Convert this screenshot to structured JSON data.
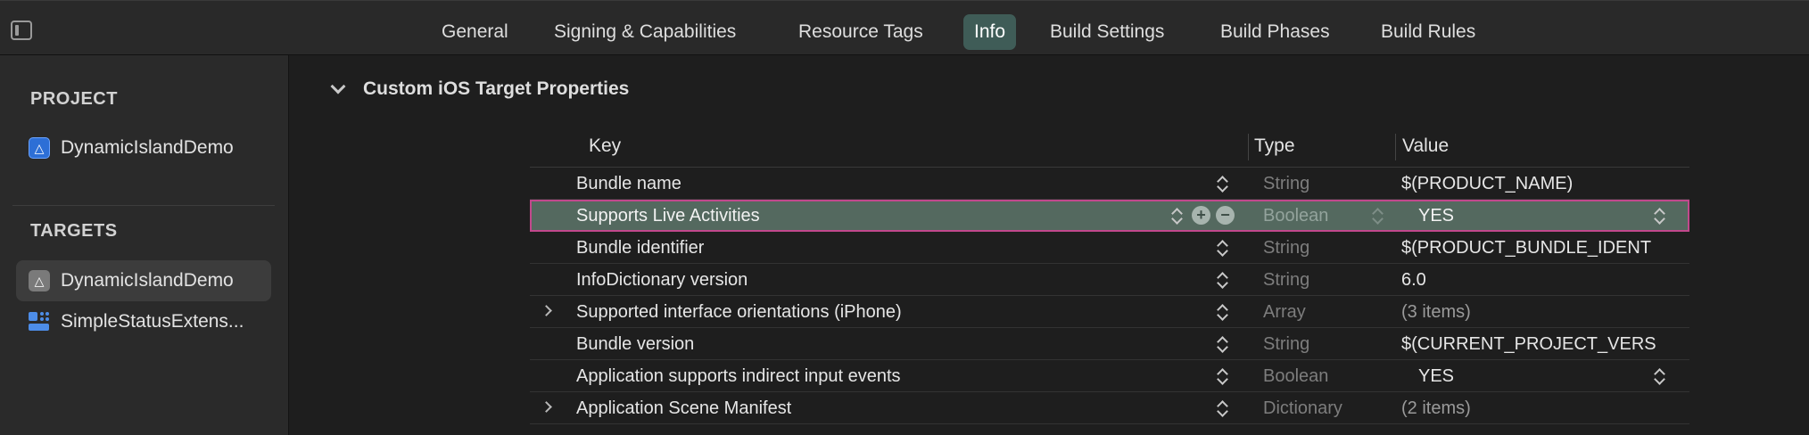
{
  "tabs": [
    {
      "label": "General"
    },
    {
      "label": "Signing & Capabilities"
    },
    {
      "label": "Resource Tags"
    },
    {
      "label": "Info",
      "active": true
    },
    {
      "label": "Build Settings"
    },
    {
      "label": "Build Phases"
    },
    {
      "label": "Build Rules"
    }
  ],
  "navigator": {
    "project_header": "PROJECT",
    "project_name": "DynamicIslandDemo",
    "targets_header": "TARGETS",
    "targets": [
      {
        "label": "DynamicIslandDemo",
        "selected": true,
        "icon": "app-target-icon"
      },
      {
        "label": "SimpleStatusExtens...",
        "selected": false,
        "icon": "extension-target-icon"
      }
    ]
  },
  "section": {
    "title": "Custom iOS Target Properties"
  },
  "table": {
    "headers": {
      "key": "Key",
      "type": "Type",
      "value": "Value"
    },
    "rows": [
      {
        "key": "Bundle name",
        "type": "String",
        "value": "$(PRODUCT_NAME)"
      },
      {
        "key": "Supports Live Activities",
        "type": "Boolean",
        "value": "YES",
        "selected": true
      },
      {
        "key": "Bundle identifier",
        "type": "String",
        "value": "$(PRODUCT_BUNDLE_IDENT"
      },
      {
        "key": "InfoDictionary version",
        "type": "String",
        "value": "6.0"
      },
      {
        "key": "Supported interface orientations (iPhone)",
        "type": "Array",
        "value": "(3 items)",
        "expandable": true
      },
      {
        "key": "Bundle version",
        "type": "String",
        "value": "$(CURRENT_PROJECT_VERS"
      },
      {
        "key": "Application supports indirect input events",
        "type": "Boolean",
        "value": "YES"
      },
      {
        "key": "Application Scene Manifest",
        "type": "Dictionary",
        "value": "(2 items)",
        "expandable": true
      }
    ]
  },
  "colors": {
    "accent_tab": "#3f5c57",
    "selected_row": "#54695f",
    "selected_row_border": "#c2488c"
  }
}
